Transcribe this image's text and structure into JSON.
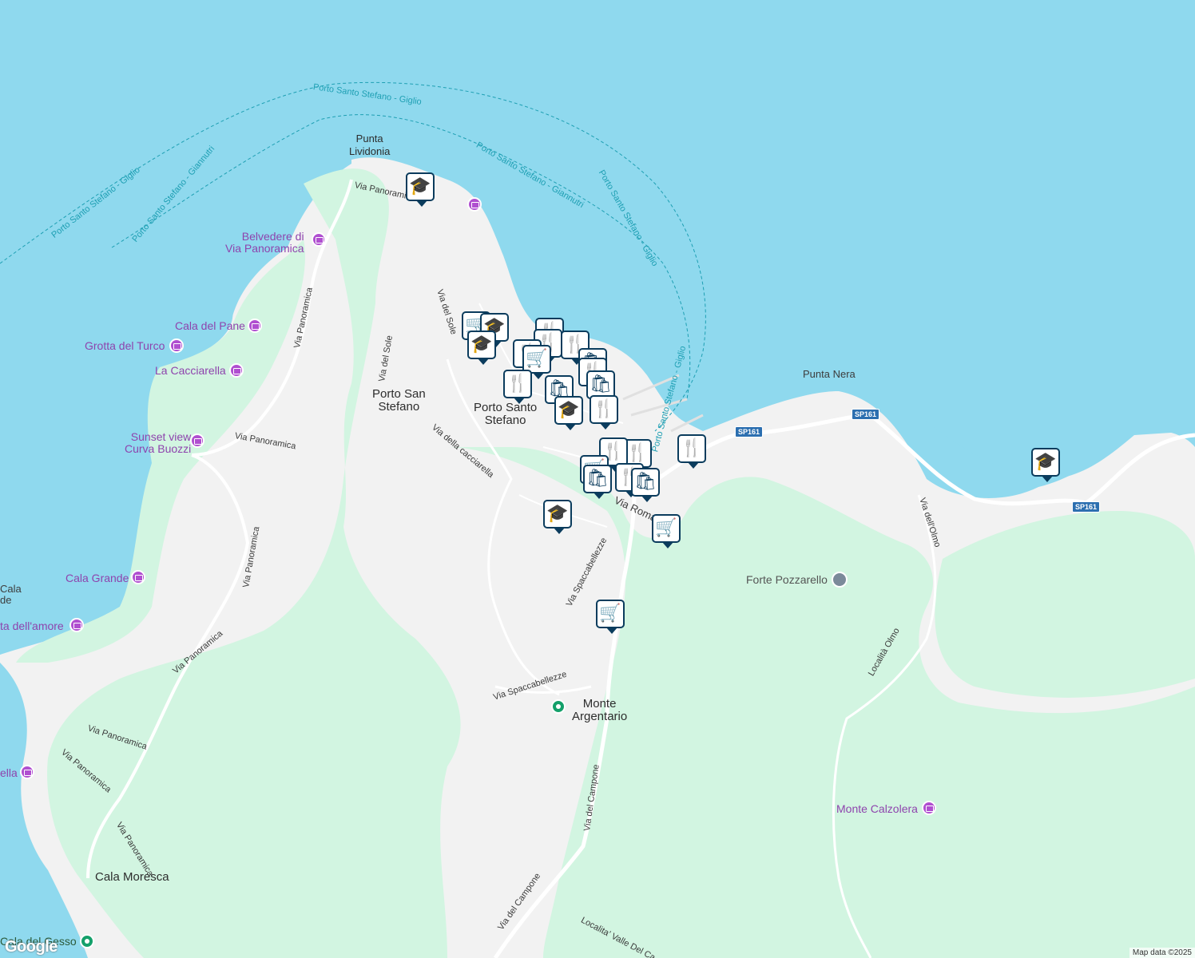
{
  "map": {
    "colors": {
      "water": "#8fd9ee",
      "land": "#f2f2f2",
      "park": "#d2f5e1",
      "road": "#ffffff",
      "ferry": "#1e9fb3",
      "poi": "#b04fd0",
      "pin_border": "#0b3c5d"
    },
    "places": {
      "punta_lividonia": "Punta\nLividonia",
      "porto_san_stefano": "Porto San\nStefano",
      "porto_santo_stefano": "Porto Santo\nStefano",
      "punta_nera": "Punta Nera",
      "monte_argentario": "Monte\nArgentario",
      "cala_moresca": "Cala Moresca",
      "cala_edge": "Cala\nde"
    },
    "pois": {
      "belvedere": "Belvedere di\nVia Panoramica",
      "cala_del_pane": "Cala del Pane",
      "grotta_del_turco": "Grotta del Turco",
      "la_cacciarella": "La Cacciarella",
      "sunset_view": "Sunset view\nCurva Buozzi",
      "cala_grande": "Cala Grande",
      "dell_amore": "ta dell'amore",
      "ella": "ella",
      "forte_pozzarello": "Forte Pozzarello",
      "monte_calzolera": "Monte Calzolera",
      "cala_del_gesso": "Cala del Gesso"
    },
    "roads": {
      "via_panoramica": "Via Panoramica",
      "via_del_sole": "Via del Sole",
      "via_della_cacciarella": "Via della cacciarella",
      "via_roma": "Via Roma",
      "via_spaccabellezze": "Via Spaccabellezze",
      "via_del_campone": "Via del Campone",
      "via_dell_olmo": "Via dell'Olmo",
      "localita_olmo": "Località Olmo",
      "localita_valle": "Localita' Valle Del Ca",
      "sp161": "SP161"
    },
    "ferries": {
      "giglio": "Porto Santo Stefano - Giglio",
      "giannutri": "Porto Santo Stefano - Giannutri"
    },
    "pin_icons": {
      "restaurant": "🍴",
      "school": "🎓",
      "shop": "🛍",
      "cart": "🛒"
    },
    "google_logo": "Google",
    "attribution": "Map data ©2025"
  }
}
